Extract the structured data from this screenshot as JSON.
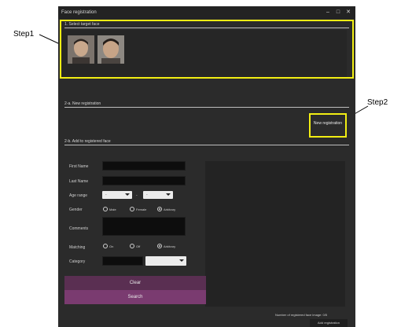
{
  "callouts": {
    "step1": "Step1",
    "step2": "Step2"
  },
  "window": {
    "title": "Face registration",
    "min": "–",
    "max": "□",
    "close": "✕"
  },
  "section1": {
    "title": "1. Select target face"
  },
  "section2a": {
    "title": "2-a. New registration",
    "button": "New registration"
  },
  "section2b": {
    "title": "2-b. Add to registered face"
  },
  "form": {
    "first_name_label": "First Name",
    "last_name_label": "Last Name",
    "age_range_label": "Age range",
    "age_from": "-",
    "age_sep": "-",
    "age_to": "-",
    "gender_label": "Gender",
    "gender_options": [
      "Male",
      "Female",
      "Arbitrary"
    ],
    "comments_label": "Comments",
    "matching_label": "Matching",
    "matching_options": [
      "On",
      "Off",
      "Arbitrary"
    ],
    "category_label": "Category"
  },
  "buttons": {
    "clear": "Clear",
    "search": "Search",
    "add": "Add registration"
  },
  "status": {
    "registered_count": "Number of registered face image: 0/5"
  },
  "colors": {
    "highlight": "#f2ee13",
    "purple_dark": "#5a2f52",
    "purple": "#7a3b70"
  }
}
